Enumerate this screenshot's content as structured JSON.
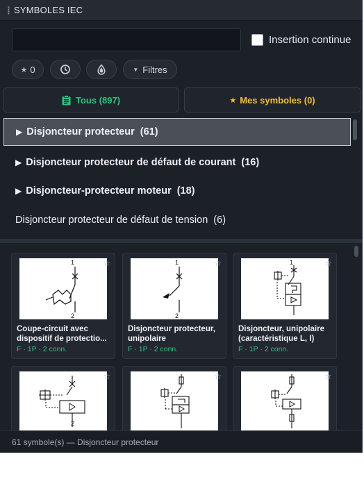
{
  "panel": {
    "title": "SYMBOLES IEC"
  },
  "search": {
    "value": "",
    "placeholder": "",
    "continuous_label": "Insertion continue",
    "continuous_checked": false
  },
  "chips": [
    {
      "icon": "star-icon",
      "label": "0"
    },
    {
      "icon": "clock-icon",
      "label": ""
    },
    {
      "icon": "drop-icon",
      "label": ""
    },
    {
      "icon": "caret-down-icon",
      "label": "Filtres"
    }
  ],
  "tabs": {
    "all_label": "Tous (897)",
    "mine_label": "Mes symboles (0)",
    "star_glyph": "★"
  },
  "categories": [
    {
      "label": "Disjoncteur protecteur",
      "count": "(61)",
      "selected": true,
      "expandable": true
    },
    {
      "label": "Disjoncteur protecteur de défaut de courant",
      "count": "(16)",
      "selected": false,
      "expandable": true
    },
    {
      "label": "Disjoncteur-protecteur moteur",
      "count": "(18)",
      "selected": false,
      "expandable": true
    },
    {
      "label": "Disjoncteur protecteur de défaut de tension",
      "count": "(6)",
      "selected": false,
      "expandable": false
    }
  ],
  "arrow_glyph": "▶",
  "symbols": [
    {
      "title": "Coupe-circuit avec dispositif de protectio...",
      "meta": "F · 1P · 2 conn.",
      "top_terminal": "1",
      "bottom_terminal": "2"
    },
    {
      "title": "Disjoncteur protecteur, unipolaire",
      "meta": "F · 1P · 2 conn.",
      "top_terminal": "1",
      "bottom_terminal": "2"
    },
    {
      "title": "Disjoncteur, unipolaire (caractéristique L, I)",
      "meta": "F · 1P · 2 conn.",
      "top_terminal": "1",
      "bottom_terminal": ""
    },
    {
      "title": "",
      "meta": "",
      "top_terminal": "",
      "bottom_terminal": "2"
    },
    {
      "title": "",
      "meta": "",
      "top_terminal": "",
      "bottom_terminal": ""
    },
    {
      "title": "",
      "meta": "",
      "top_terminal": "",
      "bottom_terminal": ""
    }
  ],
  "favorite_glyph": "☆",
  "footer": {
    "status": "61 symbole(s) — Disjoncteur protecteur"
  },
  "colors": {
    "accent_green": "#2ec27e",
    "accent_gold": "#f0c030",
    "panel_bg": "#1c2027"
  }
}
